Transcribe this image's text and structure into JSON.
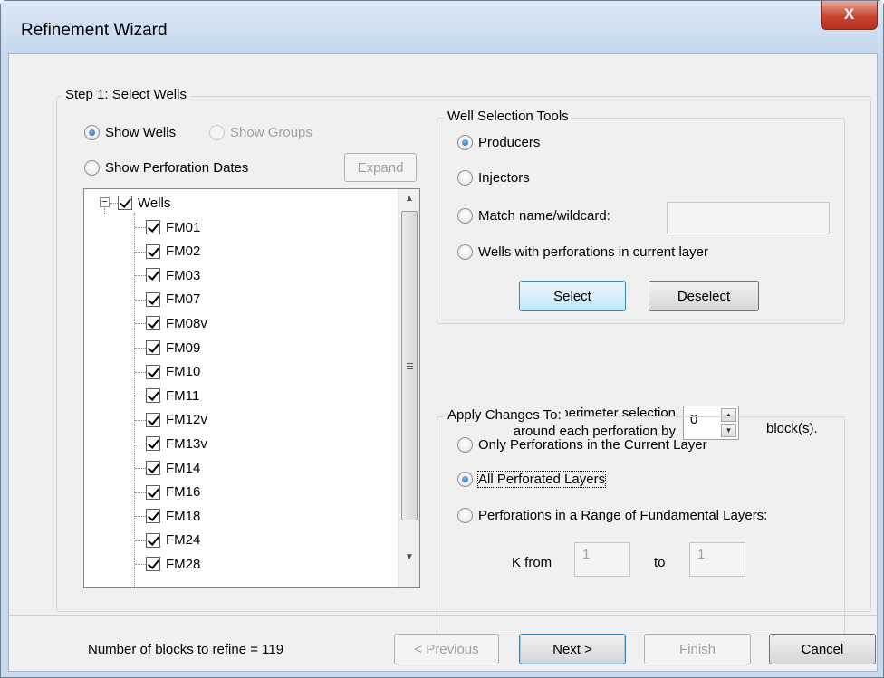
{
  "window": {
    "title": "Refinement Wizard",
    "close_label": "X"
  },
  "step1": {
    "legend": "Step 1: Select Wells",
    "show_wells": "Show Wells",
    "show_groups": "Show Groups",
    "show_perforation_dates": "Show Perforation Dates",
    "expand_button": "Expand",
    "tree": {
      "root": "Wells",
      "items": [
        "FM01",
        "FM02",
        "FM03",
        "FM07",
        "FM08v",
        "FM09",
        "FM10",
        "FM11",
        "FM12v",
        "FM13v",
        "FM14",
        "FM16",
        "FM18",
        "FM24",
        "FM28"
      ]
    }
  },
  "tools": {
    "legend": "Well Selection Tools",
    "producers": "Producers",
    "injectors": "Injectors",
    "match_name": "Match name/wildcard:",
    "match_value": "",
    "wells_with_perfs": "Wells with perforations in current layer",
    "select_button": "Select",
    "deselect_button": "Deselect"
  },
  "expand": {
    "line1": "Expand perimeter selection",
    "line2": "around each perforation by",
    "value": "0",
    "unit": "block(s)."
  },
  "apply": {
    "legend": "Apply Changes To:",
    "current_layer": "Only Perforations in the Current Layer",
    "all_layers": "All Perforated Layers",
    "range_layers": "Perforations in a Range of Fundamental Layers:",
    "k_from_label": "K from",
    "k_from_value": "1",
    "to_label": "to",
    "k_to_value": "1"
  },
  "footer": {
    "status": "Number of blocks to refine = 119",
    "previous": "< Previous",
    "next": "Next >",
    "finish": "Finish",
    "cancel": "Cancel"
  }
}
